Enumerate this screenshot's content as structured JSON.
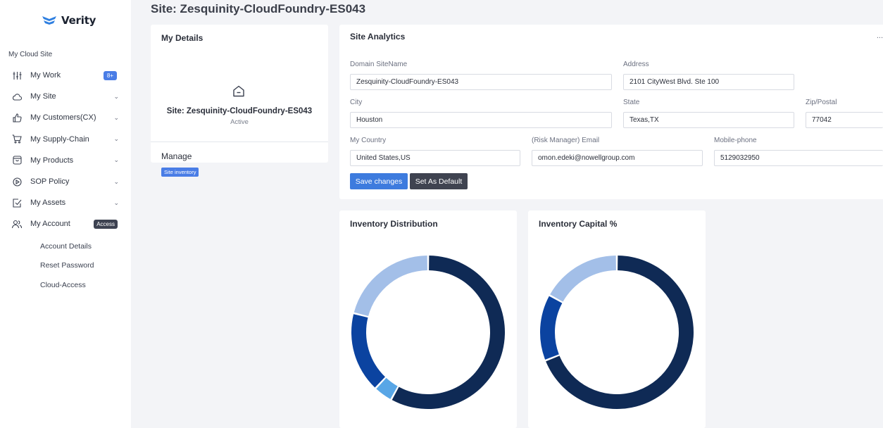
{
  "sidebar": {
    "logo_text": "Verity",
    "section_label": "My Cloud Site",
    "items": [
      {
        "label": "My Work",
        "icon": "sliders-icon",
        "badge": "8+"
      },
      {
        "label": "My Site",
        "icon": "cloud-icon"
      },
      {
        "label": "My Customers(CX)",
        "icon": "thumbs-up-icon"
      },
      {
        "label": "My Supply-Chain",
        "icon": "cart-icon"
      },
      {
        "label": "My Products",
        "icon": "box-icon"
      },
      {
        "label": "SOP Policy",
        "icon": "policy-icon"
      },
      {
        "label": "My Assets",
        "icon": "checkbox-icon"
      },
      {
        "label": "My Account",
        "icon": "users-icon",
        "badge": "Access"
      }
    ],
    "sub_items": [
      "Account Details",
      "Reset Password",
      "Cloud-Access"
    ]
  },
  "page_title": "Site: Zesquinity-CloudFoundry-ES043",
  "details": {
    "title": "My Details",
    "site_name": "Site: Zesquinity-CloudFoundry-ES043",
    "status": "Active",
    "manage_title": "Manage",
    "manage_badge": "Site inventory"
  },
  "analytics": {
    "title": "Site Analytics",
    "more": "...",
    "fields": {
      "domain": {
        "label": "Domain SiteName",
        "value": "Zesquinity-CloudFoundry-ES043"
      },
      "address": {
        "label": "Address",
        "value": "2101 CityWest Blvd. Ste 100"
      },
      "city": {
        "label": "City",
        "value": "Houston"
      },
      "state": {
        "label": "State",
        "value": "Texas,TX"
      },
      "zip": {
        "label": "Zip/Postal",
        "value": "77042"
      },
      "country": {
        "label": "My Country",
        "value": "United States,US"
      },
      "email": {
        "label": "(Risk Manager) Email",
        "value": "omon.edeki@nowellgroup.com"
      },
      "phone": {
        "label": "Mobile-phone",
        "value": "5129032950"
      }
    },
    "save_label": "Save changes",
    "default_label": "Set As Default"
  },
  "colors": {
    "accent": "#3d7bde",
    "navy": "#0f2a55",
    "blue": "#0b43a0",
    "light_blue": "#58a6e6",
    "pale_blue": "#a3bfe8"
  },
  "chart_data": [
    {
      "type": "pie",
      "title": "Inventory Distribution",
      "slices": [
        {
          "value": 58,
          "color": "#0f2a55"
        },
        {
          "value": 4,
          "color": "#58a6e6"
        },
        {
          "value": 17,
          "color": "#0b43a0"
        },
        {
          "value": 21,
          "color": "#a3bfe8"
        }
      ]
    },
    {
      "type": "pie",
      "title": "Inventory Capital %",
      "slices": [
        {
          "value": 69,
          "color": "#0f2a55"
        },
        {
          "value": 14,
          "color": "#0b43a0"
        },
        {
          "value": 17,
          "color": "#a3bfe8"
        }
      ]
    }
  ]
}
